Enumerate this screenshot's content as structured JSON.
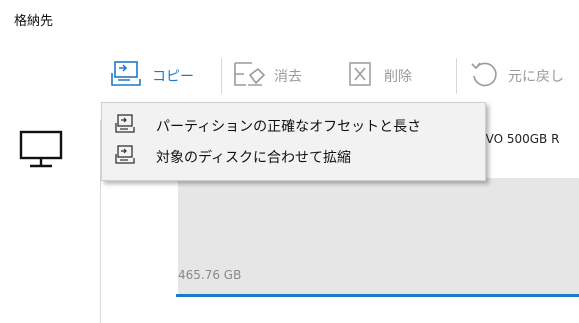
{
  "section": {
    "title": "格納先"
  },
  "toolbar": {
    "copy_label": "コピー",
    "erase_label": "消去",
    "delete_label": "削除",
    "undo_label": "元に戻し"
  },
  "dropdown": {
    "items": [
      {
        "label": "パーティションの正確なオフセットと長さ",
        "icon": "copy-partition-icon"
      },
      {
        "label": "対象のディスクに合わせて拡縮",
        "icon": "copy-resize-icon"
      }
    ]
  },
  "disk": {
    "model_text": "EVO 500GB R",
    "partition_size": "465.76 GB"
  },
  "colors": {
    "accent": "#1f79c9",
    "disabled": "#9a9a9a",
    "partition_fill": "#e6e6e6",
    "menu_bg": "#f2f2f2"
  }
}
